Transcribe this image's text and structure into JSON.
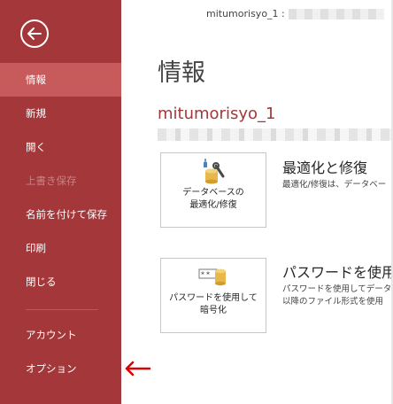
{
  "title_bar": {
    "text": "mitumorisyo_1 :"
  },
  "sidebar": {
    "items": [
      {
        "label": "情報"
      },
      {
        "label": "新規"
      },
      {
        "label": "開く"
      },
      {
        "label": "上書き保存"
      },
      {
        "label": "名前を付けて保存"
      },
      {
        "label": "印刷"
      },
      {
        "label": "閉じる"
      },
      {
        "label": "アカウント"
      },
      {
        "label": "オプション"
      }
    ]
  },
  "main": {
    "page_title": "情報",
    "database_name": "mitumorisyo_1",
    "compact": {
      "button_label_line1": "データベースの",
      "button_label_line2": "最適化/修復",
      "heading": "最適化と修復",
      "description": "最適化/修復は、データベー"
    },
    "password": {
      "button_label_line1": "パスワードを使用して",
      "button_label_line2": "暗号化",
      "heading": "パスワードを使用",
      "description_line1": "パスワードを使用してデータ",
      "description_line2": "以降のファイル形式を使用"
    }
  },
  "colors": {
    "sidebar_bg": "#a4373a",
    "sidebar_selected": "#c75a5a",
    "accent_red": "#a4373a",
    "annotation_arrow": "#e00000"
  },
  "icons": {
    "back": "back-arrow-icon",
    "compact": "database-compact-repair-icon",
    "password": "database-password-icon",
    "annotation": "red-arrow-icon"
  }
}
